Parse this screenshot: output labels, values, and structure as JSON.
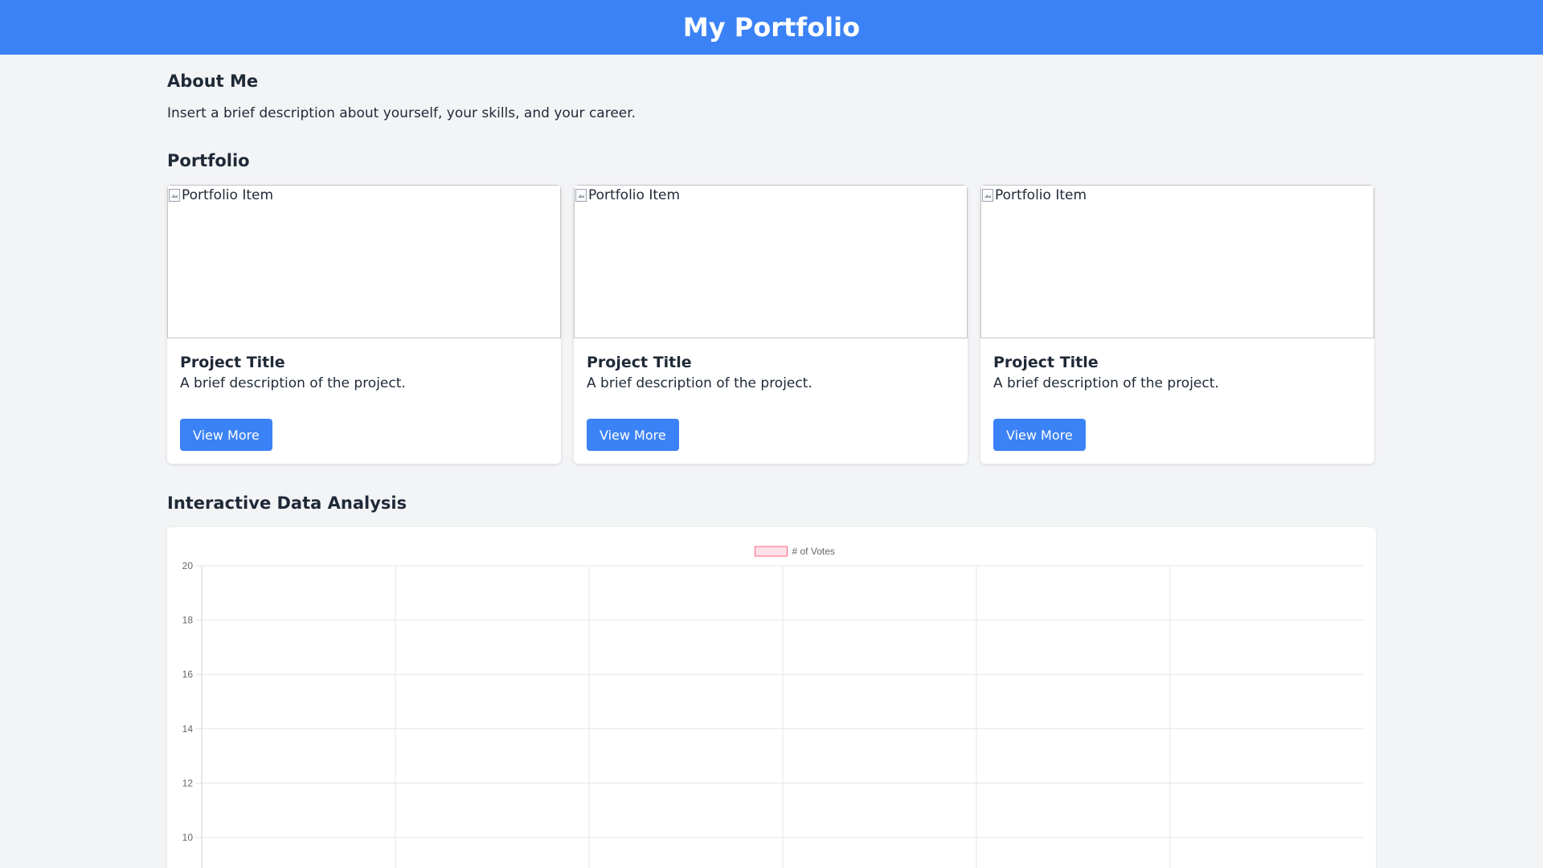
{
  "header": {
    "title": "My Portfolio"
  },
  "about": {
    "title": "About Me",
    "text": "Insert a brief description about yourself, your skills, and your career."
  },
  "portfolio": {
    "title": "Portfolio",
    "items": [
      {
        "image_alt": "Portfolio Item",
        "title": "Project Title",
        "description": "A brief description of the project.",
        "button_label": "View More"
      },
      {
        "image_alt": "Portfolio Item",
        "title": "Project Title",
        "description": "A brief description of the project.",
        "button_label": "View More"
      },
      {
        "image_alt": "Portfolio Item",
        "title": "Project Title",
        "description": "A brief description of the project.",
        "button_label": "View More"
      }
    ]
  },
  "analysis": {
    "title": "Interactive Data Analysis"
  },
  "colors": {
    "accent": "#3b82f6",
    "legend_fill": "#ffe0e6",
    "legend_border": "#ff6384",
    "grid": "#e5e5e5"
  },
  "chart_data": {
    "type": "bar",
    "legend": [
      "# of Votes"
    ],
    "legend_position": "top",
    "series": [
      {
        "name": "# of Votes",
        "values": []
      }
    ],
    "y_ticks": [
      20,
      18,
      16,
      14,
      12,
      10
    ],
    "x_categories_visible": 6,
    "grid": true
  }
}
